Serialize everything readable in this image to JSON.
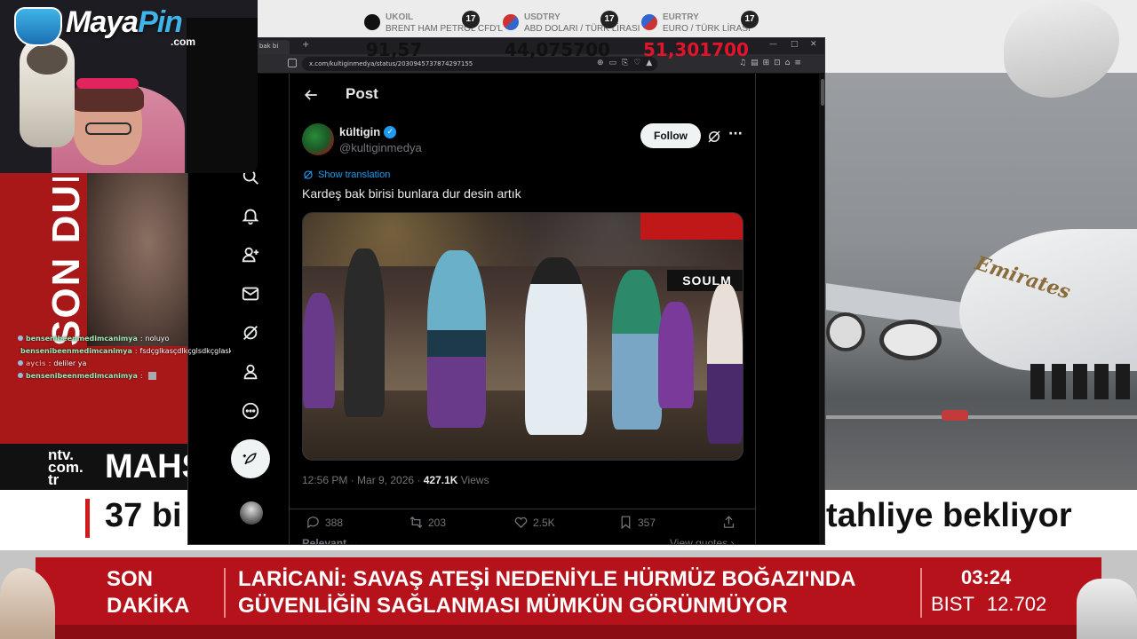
{
  "broadcast": {
    "left_vertical_text": "SON DUR",
    "ntv_logo": [
      "ntv.",
      "com.",
      "tr"
    ],
    "headline_top": "MAHS",
    "headline_left": "37 bi",
    "headline_right": "tahliye bekliyor",
    "plane_logo": "Emirates",
    "ticker": {
      "label_line1": "SON",
      "label_line2": "DAKİKA",
      "news_line1": "LARİCANİ: SAVAŞ ATEŞİ NEDENİYLE HÜRMÜZ BOĞAZI'NDA",
      "news_line2": "GÜVENLİĞİN SAĞLANMASI MÜMKÜN GÖRÜNMÜYOR",
      "time": "03:24",
      "bist_label": "BIST",
      "bist_value": "12.702"
    }
  },
  "markets": [
    {
      "symbol": "UKOIL",
      "desc": "BRENT HAM PETROL CFD'L",
      "value": "91,57",
      "color": "#111111"
    },
    {
      "symbol": "USDTRY",
      "desc": "ABD DOLARI / TÜRK LİRASI",
      "value": "44,075700",
      "color": "#111111"
    },
    {
      "symbol": "EURTRY",
      "desc": "EURO / TÜRK LİRASI",
      "value": "51,301700",
      "color": "#e0142a"
    }
  ],
  "overlay": {
    "logo_main": "Maya",
    "logo_accent": "Pin",
    "logo_suffix": ".com"
  },
  "chat": [
    {
      "user": "bensenibeenmedimcanimya",
      "message": "noluyo",
      "red": false
    },
    {
      "user": "bensenibeenmedimcanimya",
      "message": "fsdçglkasçdlkçglsdkçglask",
      "red": false
    },
    {
      "user": "aycis",
      "message": "deliler ya",
      "red": true
    },
    {
      "user": "bensenibeenmedimcanimya",
      "message": "",
      "red": false
    }
  ],
  "browser": {
    "tab_title": "ş bak bi",
    "new_tab": "+",
    "url": "x.com/kultiginmedya/status/2030945737874297155"
  },
  "post": {
    "header_title": "Post",
    "author_name": "kültigin",
    "verified_mark": "✓",
    "author_handle": "@kultiginmedya",
    "follow_label": "Follow",
    "more": "···",
    "show_translation": "Show translation",
    "text": "Kardeş bak birisi bunlara dur desin artık",
    "media_sign": "SOULM",
    "timestamp": "12:56 PM · Mar 9, 2026 · ",
    "views_count": "427.1K",
    "views_label": " Views",
    "replies": "388",
    "reposts": "203",
    "likes": "2.5K",
    "bookmarks": "357",
    "relevant_label": "Relevant ⌄",
    "view_quotes_label": "View quotes ›"
  }
}
